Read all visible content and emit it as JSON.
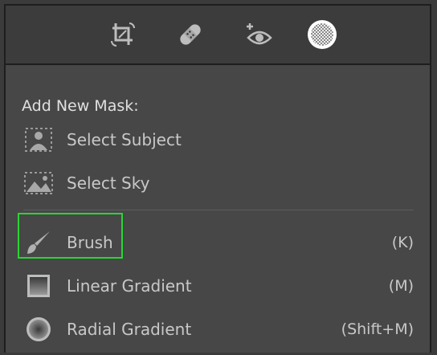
{
  "toolbar": {
    "tools": [
      {
        "name": "crop-icon"
      },
      {
        "name": "healing-icon"
      },
      {
        "name": "red-eye-icon"
      },
      {
        "name": "masking-icon"
      }
    ]
  },
  "panel": {
    "title": "Add New Mask:",
    "items": [
      {
        "label": "Select Subject",
        "shortcut": "",
        "icon": "select-subject-icon"
      },
      {
        "label": "Select Sky",
        "shortcut": "",
        "icon": "select-sky-icon"
      },
      {
        "label": "Brush",
        "shortcut": "(K)",
        "icon": "brush-icon"
      },
      {
        "label": "Linear Gradient",
        "shortcut": "(M)",
        "icon": "linear-gradient-icon"
      },
      {
        "label": "Radial Gradient",
        "shortcut": "(Shift+M)",
        "icon": "radial-gradient-icon"
      }
    ]
  },
  "colors": {
    "highlight": "#2bd434"
  }
}
